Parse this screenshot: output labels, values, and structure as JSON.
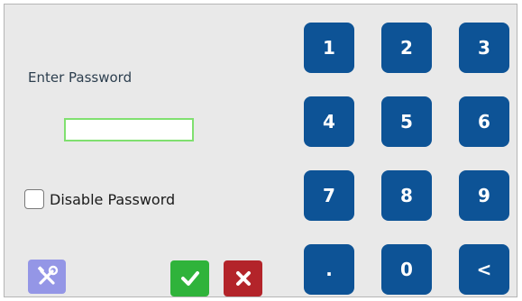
{
  "login": {
    "prompt": "Enter Password",
    "password_value": "",
    "disable_label": "Disable Password",
    "disable_checked": false
  },
  "keypad": {
    "keys": [
      "1",
      "2",
      "3",
      "4",
      "5",
      "6",
      "7",
      "8",
      "9",
      ".",
      "0",
      "<"
    ]
  },
  "actions": {
    "tools_icon": "tools-icon",
    "confirm_icon": "checkmark-icon",
    "cancel_icon": "x-icon"
  },
  "colors": {
    "key_bg": "#0d5396",
    "field_border": "#80e070",
    "confirm_bg": "#2fb33b",
    "cancel_bg": "#b3242a",
    "tools_bg": "#9496e6",
    "panel_bg": "#e9e9e9"
  }
}
